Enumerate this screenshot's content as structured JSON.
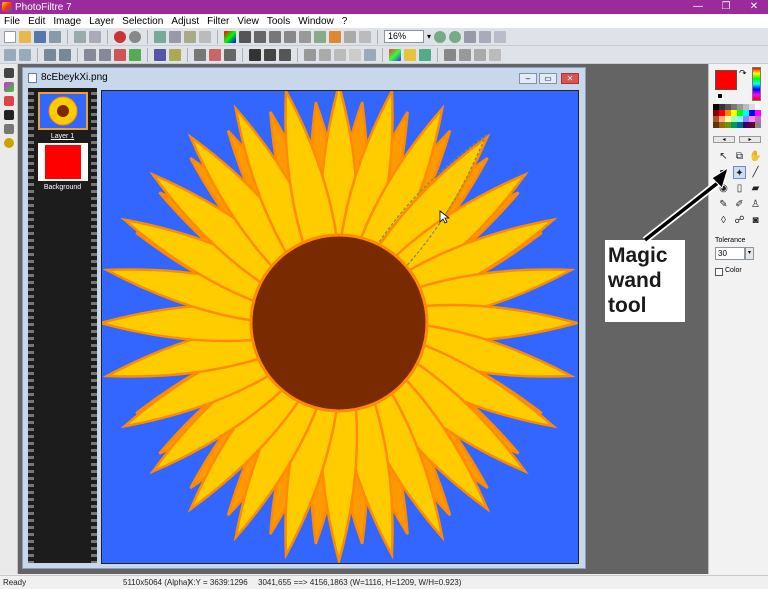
{
  "app": {
    "title": "PhotoFiltre 7"
  },
  "window_controls": {
    "minimize": "—",
    "maximize": "❐",
    "close": "✕"
  },
  "menu": [
    "File",
    "Edit",
    "Image",
    "Layer",
    "Selection",
    "Adjust",
    "Filter",
    "View",
    "Tools",
    "Window",
    "?"
  ],
  "toolbar": {
    "zoom_value": "16%",
    "zoom_arrow": "▾"
  },
  "document": {
    "filename": "8cEbeykXi.png",
    "buttons": {
      "minimize": "–",
      "restore": "▭",
      "close": "✕"
    },
    "layers": [
      {
        "name": "Layer 1",
        "selected": true
      },
      {
        "name": "Background",
        "selected": false
      }
    ]
  },
  "colors": {
    "accent_titlebar": "#9b2a9b",
    "foreground": "#ff0000",
    "background": "#000000",
    "canvas_bg": "#3366ff",
    "petal_fill": "#ffcc00",
    "petal_back": "#ff9900",
    "petal_stroke": "#ff8a00",
    "center": "#7a2a00"
  },
  "tools_panel": {
    "tools": [
      {
        "name": "pointer-tool-icon",
        "glyph": "↖"
      },
      {
        "name": "layer-move-tool-icon",
        "glyph": "⧉"
      },
      {
        "name": "hand-tool-icon",
        "glyph": "✋"
      },
      {
        "name": "eyedropper-tool-icon",
        "glyph": "✒"
      },
      {
        "name": "magic-wand-tool-icon",
        "glyph": "✦"
      },
      {
        "name": "line-tool-icon",
        "glyph": "╱"
      },
      {
        "name": "fill-bucket-tool-icon",
        "glyph": "◉"
      },
      {
        "name": "spray-tool-icon",
        "glyph": "▯"
      },
      {
        "name": "eraser-tool-icon",
        "glyph": "▰"
      },
      {
        "name": "brush-tool-icon",
        "glyph": "✎"
      },
      {
        "name": "advanced-brush-tool-icon",
        "glyph": "✐"
      },
      {
        "name": "stamp-tool-icon",
        "glyph": "♙"
      },
      {
        "name": "blur-tool-icon",
        "glyph": "◊"
      },
      {
        "name": "smudge-tool-icon",
        "glyph": "☍"
      },
      {
        "name": "clone-tool-icon",
        "glyph": "◙"
      }
    ],
    "active_tool": "magic-wand-tool-icon",
    "swap_glyph": "↷",
    "tolerance_label": "Tolerance",
    "tolerance_value": "30",
    "tolerance_arrow": "▾",
    "color_label": "Color",
    "color_checked": false,
    "palette_nav_left": "◂",
    "palette_nav_right": "▸"
  },
  "annotation": {
    "line1": "Magic",
    "line2": "wand",
    "line3": "tool"
  },
  "status": {
    "ready": "Ready",
    "dimensions": "5110x5064 (Alpha)",
    "cursor": "X:Y = 3639:1296",
    "selection": "3041,655 ==> 4156,1863 (W=1116, H=1209, W/H=0.923)"
  }
}
